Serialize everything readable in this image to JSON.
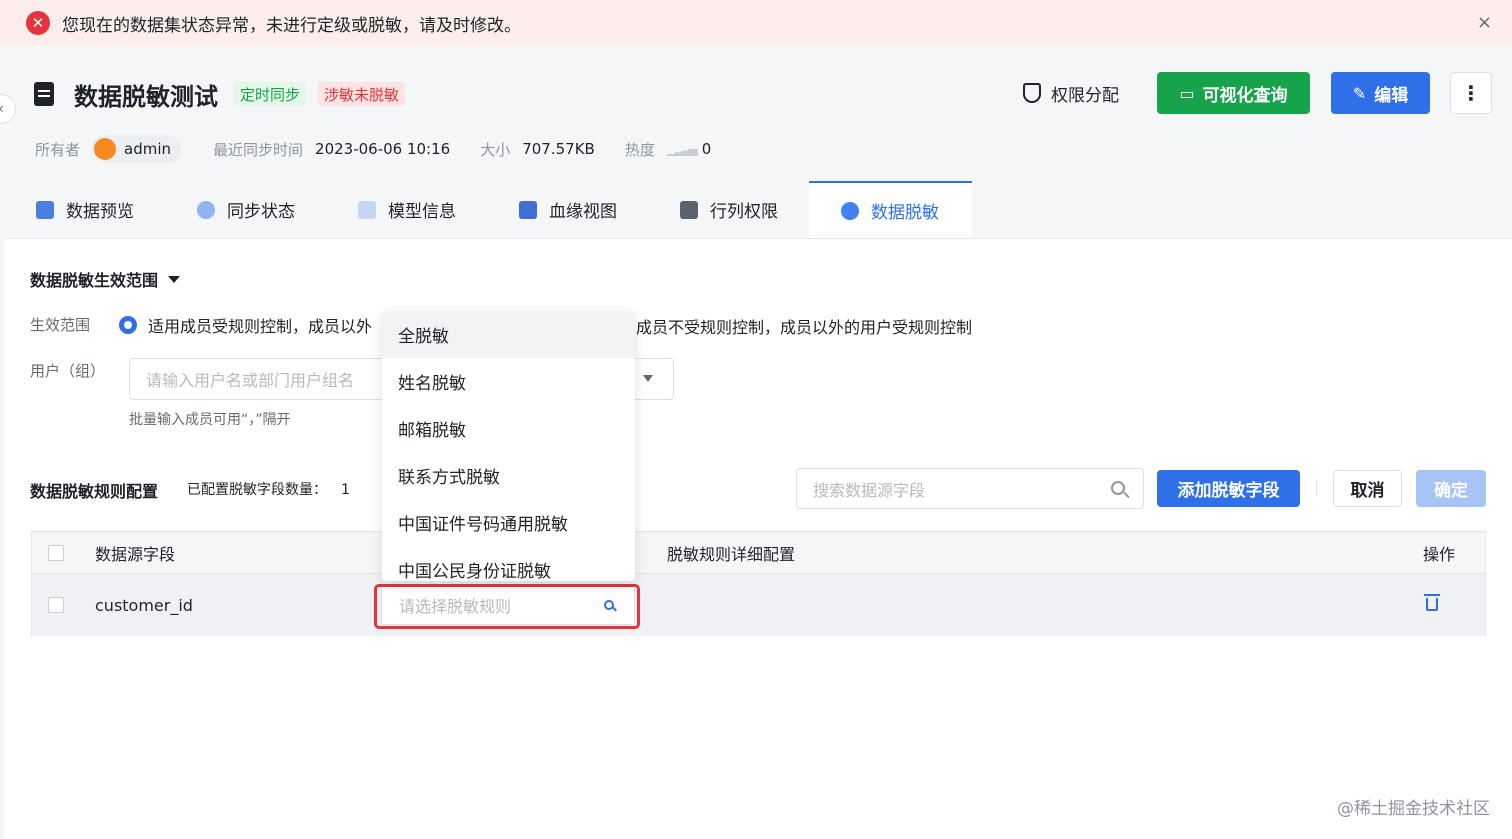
{
  "alert": {
    "text": "您现在的数据集状态异常，未进行定级或脱敏，请及时修改。",
    "icon": "error-icon",
    "close": "×"
  },
  "header": {
    "title": "数据脱敏测试",
    "tags": [
      "定时同步",
      "涉敏未脱敏"
    ],
    "perm_label": "权限分配",
    "visual_query_label": "可视化查询",
    "edit_label": "编辑",
    "more_label": "⋮"
  },
  "meta": {
    "owner_label": "所有者",
    "owner_name": "admin",
    "sync_label": "最近同步时间",
    "sync_value": "2023-06-06 10:16",
    "size_label": "大小",
    "size_value": "707.57KB",
    "heat_label": "热度",
    "heat_value": "0"
  },
  "tabs": [
    {
      "label": "数据预览",
      "icon": "grid-icon"
    },
    {
      "label": "同步状态",
      "icon": "sync-icon"
    },
    {
      "label": "模型信息",
      "icon": "model-icon"
    },
    {
      "label": "血缘视图",
      "icon": "lineage-icon"
    },
    {
      "label": "行列权限",
      "icon": "permission-icon"
    },
    {
      "label": "数据脱敏",
      "icon": "mask-icon",
      "active": true
    }
  ],
  "scope": {
    "title": "数据脱敏生效范围",
    "scope_label": "生效范围",
    "option1": "适用成员受规则控制，成员以外",
    "option2": "成员不受规则控制，成员以外的用户受规则控制",
    "user_label": "用户（组）",
    "user_placeholder": "请输入用户名或部门用户组名",
    "hint": "批量输入成员可用“，”隔开"
  },
  "rules": {
    "title": "数据脱敏规则配置",
    "count_label": "已配置脱敏字段数量：",
    "count_value": "1",
    "search_placeholder": "搜索数据源字段",
    "add_label": "添加脱敏字段",
    "cancel_label": "取消",
    "ok_label": "确定"
  },
  "table": {
    "headers": [
      "数据源字段",
      "脱敏规则详细配置",
      "操作"
    ],
    "rows": [
      {
        "field": "customer_id",
        "rule_placeholder": "请选择脱敏规则"
      }
    ]
  },
  "dropdown": {
    "options": [
      "全脱敏",
      "姓名脱敏",
      "邮箱脱敏",
      "联系方式脱敏",
      "中国证件号码通用脱敏",
      "中国公民身份证脱敏"
    ]
  },
  "footer_watermark": "@稀土掘金技术社区",
  "colors": {
    "primary": "#2f6fe8",
    "success": "#17a34a",
    "danger": "#e5343d"
  }
}
